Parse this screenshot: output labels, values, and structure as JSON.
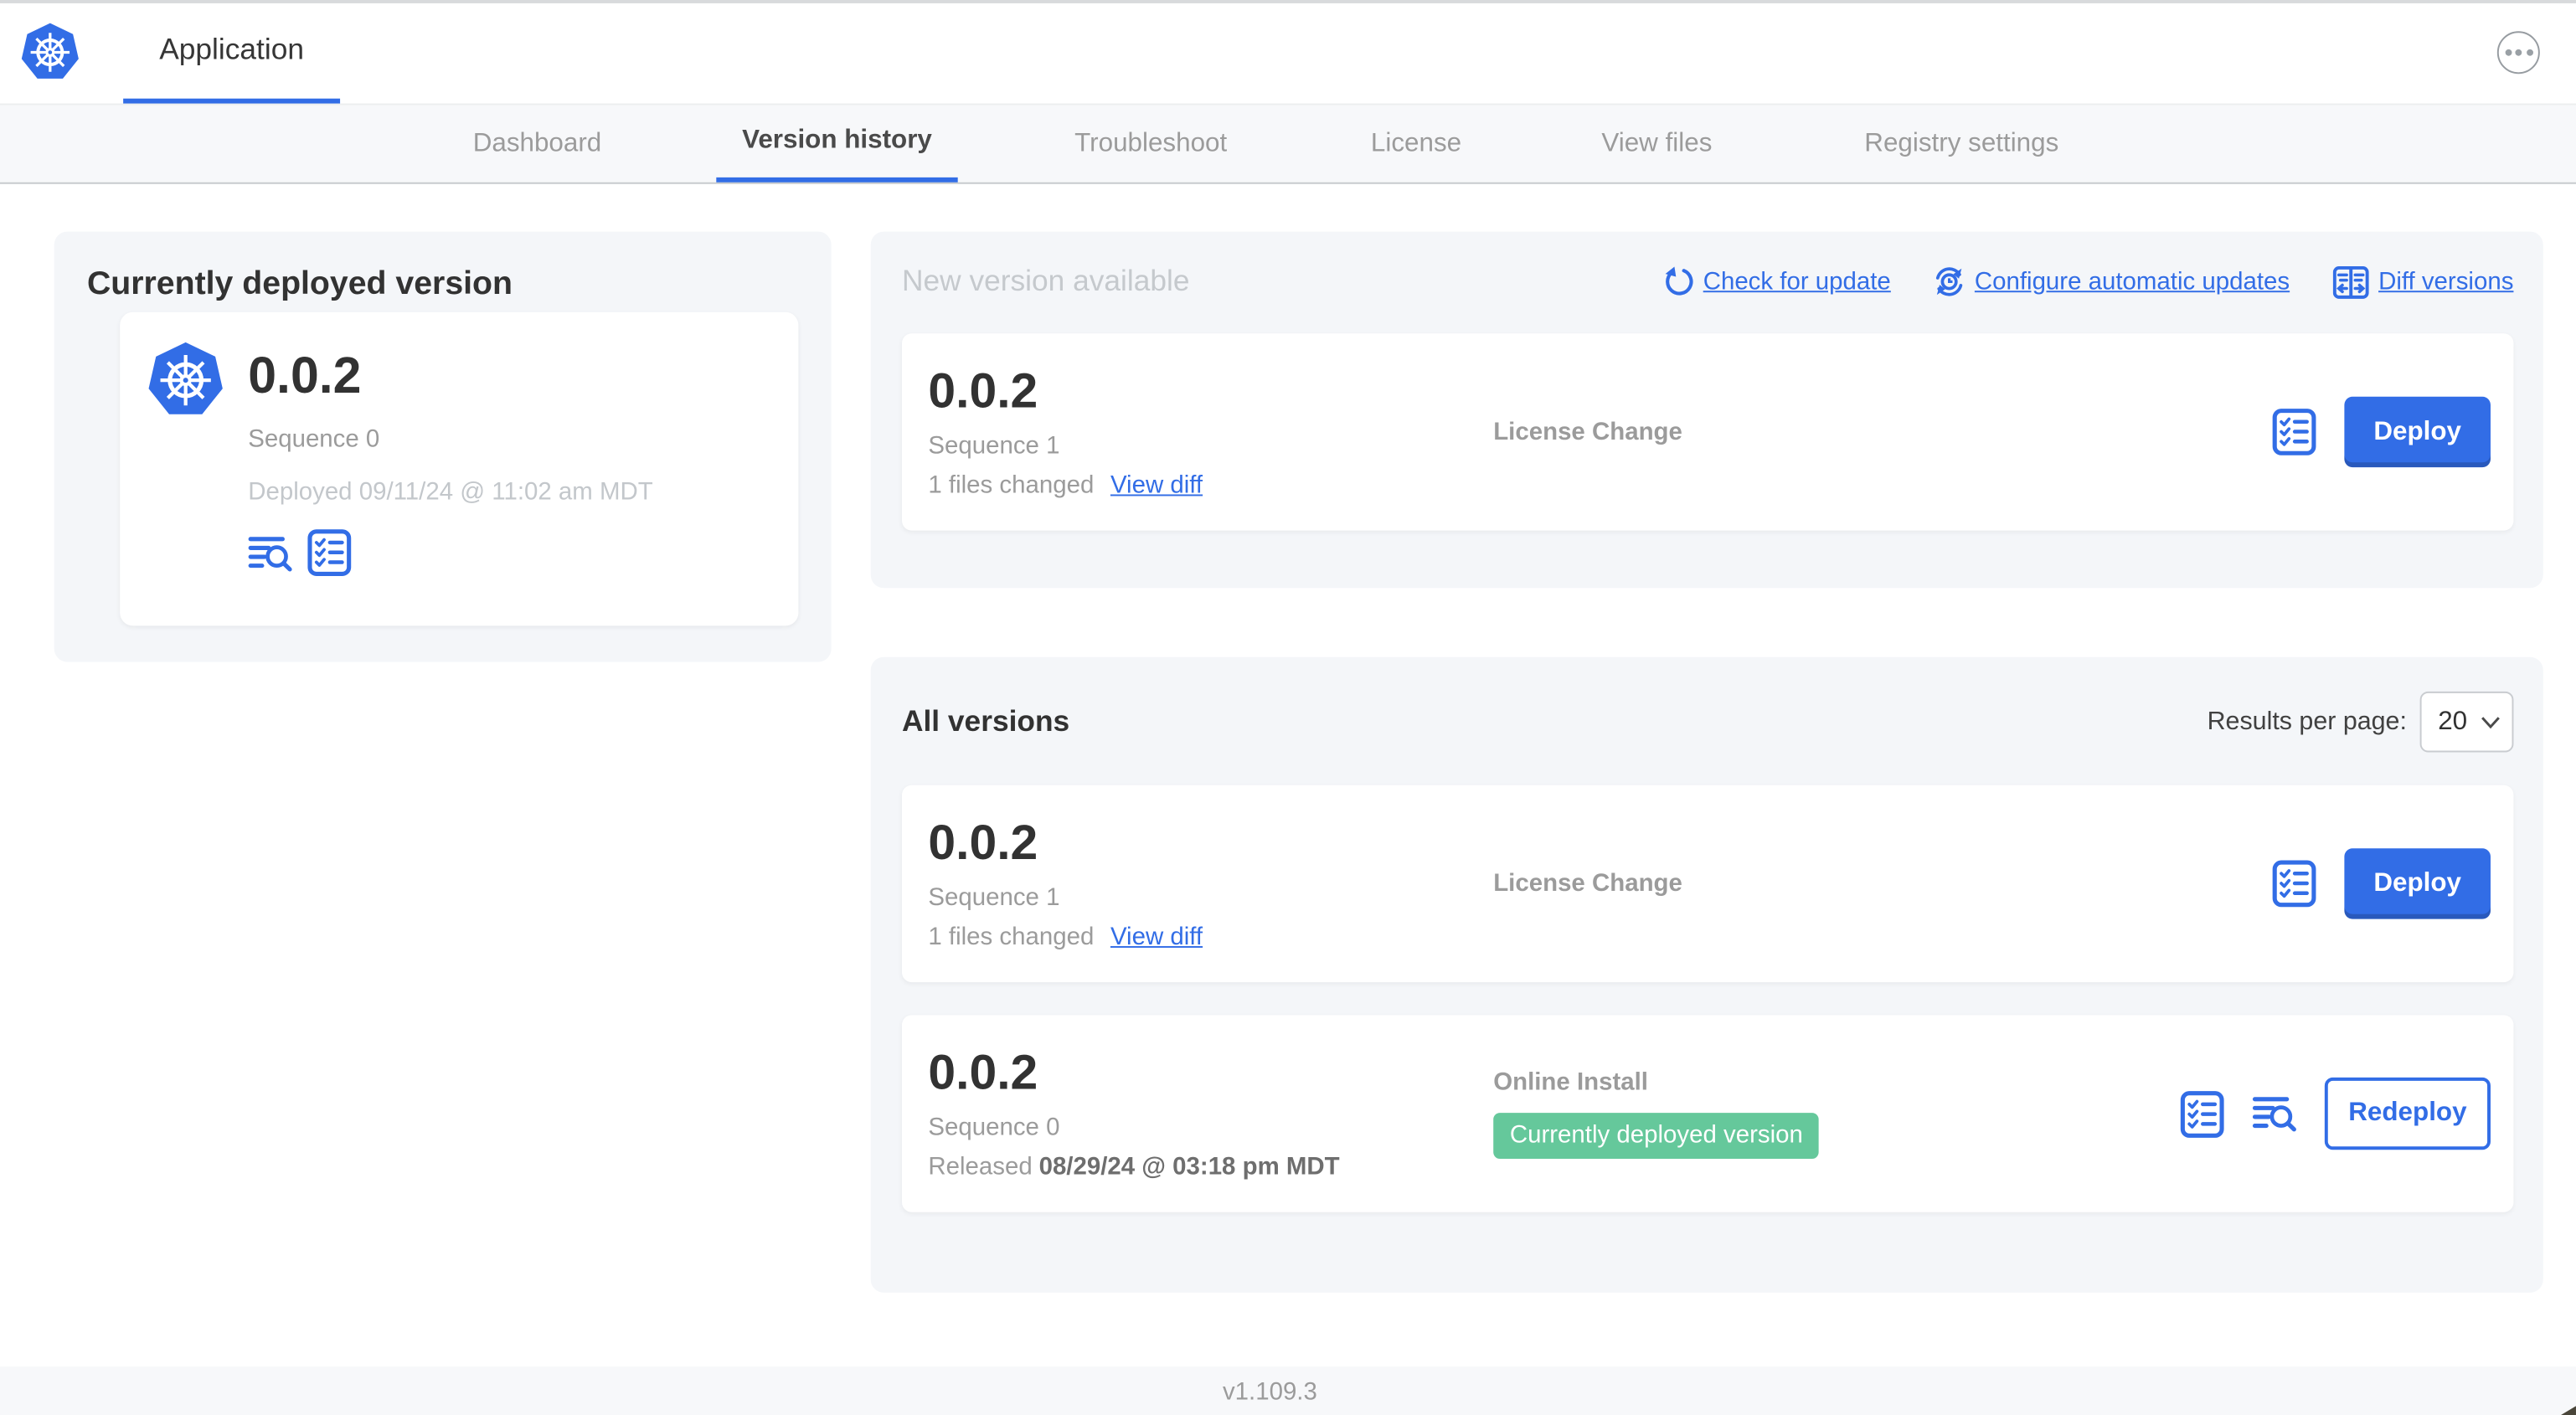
{
  "app": {
    "title": "Application",
    "console_version": "v1.109.3"
  },
  "nav": {
    "tabs": [
      "Dashboard",
      "Version history",
      "Troubleshoot",
      "License",
      "View files",
      "Registry settings"
    ],
    "active_tab": "Version history"
  },
  "current_version_card": {
    "title": "Currently deployed version",
    "version": "0.0.2",
    "sequence": "Sequence 0",
    "deployed_at": "Deployed 09/11/24 @ 11:02 am MDT"
  },
  "new_version": {
    "title": "New version available",
    "check_for_update": "Check for update",
    "configure_updates": "Configure automatic updates",
    "diff_versions": "Diff versions",
    "entry": {
      "version": "0.0.2",
      "sequence": "Sequence 1",
      "files_changed": "1 files changed",
      "view_diff": "View diff",
      "source": "License Change",
      "action": "Deploy"
    }
  },
  "all_versions": {
    "title": "All versions",
    "results_per_page_label": "Results per page:",
    "results_per_page": "20",
    "rows": [
      {
        "version": "0.0.2",
        "sequence": "Sequence 1",
        "files_changed": "1 files changed",
        "view_diff": "View diff",
        "source": "License Change",
        "action": "Deploy"
      },
      {
        "version": "0.0.2",
        "sequence": "Sequence 0",
        "released_prefix": "Released",
        "released_date": "08/29/24 @ 03:18 pm MDT",
        "source": "Online Install",
        "badge": "Currently deployed version",
        "action": "Redeploy"
      }
    ]
  },
  "icons": {
    "kubernetes-logo": "blue heptagon with white ship wheel",
    "ellipsis-menu-icon": "circle with three dots",
    "refresh-icon": "circular arrow",
    "clock-refresh-icon": "clock with circular arrows",
    "diff-icon": "split panel with left/right arrows",
    "checklist-icon": "bordered list with checkmarks",
    "logs-icon": "text lines with magnifier",
    "chevron-down-icon": "v"
  },
  "colors": {
    "accent": "#326de6",
    "badge_green": "#65c89b",
    "text_dark": "#323232",
    "text_gray": "#9b9b9b"
  }
}
